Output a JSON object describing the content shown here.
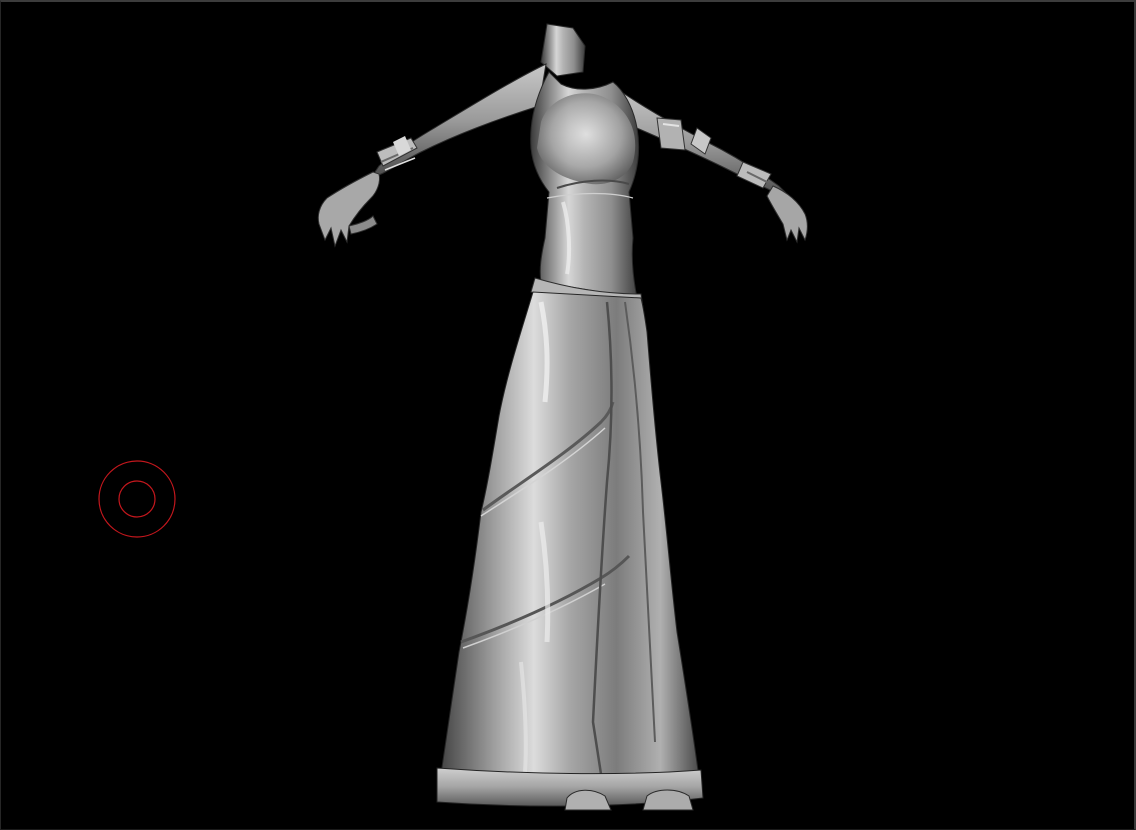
{
  "viewport": {
    "background": "#000000",
    "model_material": "grey-clay"
  },
  "brush_cursor": {
    "color": "#c4171d",
    "shape": "double-ring"
  }
}
